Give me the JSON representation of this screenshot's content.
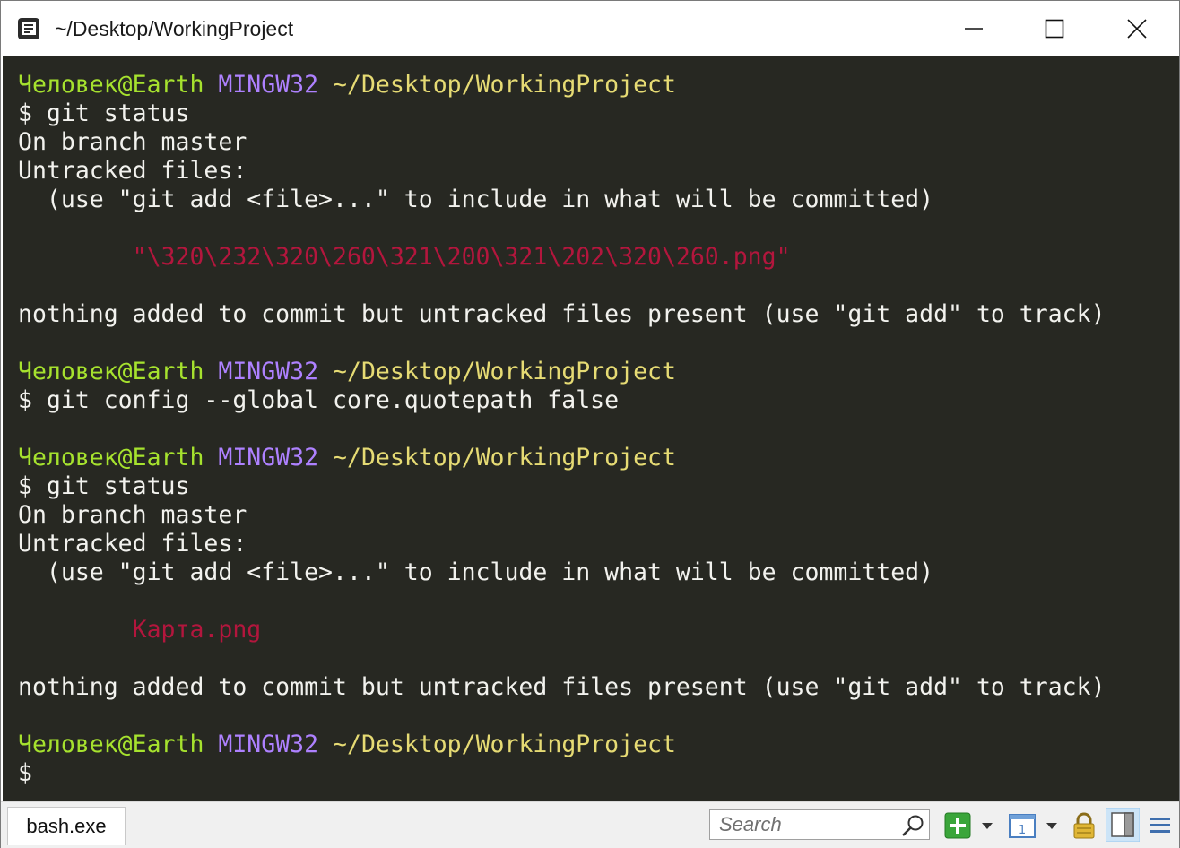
{
  "window": {
    "title": "~/Desktop/WorkingProject"
  },
  "terminal": {
    "lines": [
      {
        "type": "prompt",
        "user": "Человек@Earth",
        "host": "MINGW32",
        "path": "~/Desktop/WorkingProject"
      },
      {
        "type": "text",
        "text": "$ git status"
      },
      {
        "type": "text",
        "text": "On branch master"
      },
      {
        "type": "text",
        "text": "Untracked files:"
      },
      {
        "type": "text",
        "text": "  (use \"git add <file>...\" to include in what will be committed)"
      },
      {
        "type": "text",
        "text": ""
      },
      {
        "type": "untracked",
        "text": "        \"\\320\\232\\320\\260\\321\\200\\321\\202\\320\\260.png\""
      },
      {
        "type": "text",
        "text": ""
      },
      {
        "type": "text",
        "text": "nothing added to commit but untracked files present (use \"git add\" to track)"
      },
      {
        "type": "text",
        "text": ""
      },
      {
        "type": "prompt",
        "user": "Человек@Earth",
        "host": "MINGW32",
        "path": "~/Desktop/WorkingProject"
      },
      {
        "type": "text",
        "text": "$ git config --global core.quotepath false"
      },
      {
        "type": "text",
        "text": ""
      },
      {
        "type": "prompt",
        "user": "Человек@Earth",
        "host": "MINGW32",
        "path": "~/Desktop/WorkingProject"
      },
      {
        "type": "text",
        "text": "$ git status"
      },
      {
        "type": "text",
        "text": "On branch master"
      },
      {
        "type": "text",
        "text": "Untracked files:"
      },
      {
        "type": "text",
        "text": "  (use \"git add <file>...\" to include in what will be committed)"
      },
      {
        "type": "text",
        "text": ""
      },
      {
        "type": "untracked",
        "text": "        Карта.png"
      },
      {
        "type": "text",
        "text": ""
      },
      {
        "type": "text",
        "text": "nothing added to commit but untracked files present (use \"git add\" to track)"
      },
      {
        "type": "text",
        "text": ""
      },
      {
        "type": "prompt",
        "user": "Человек@Earth",
        "host": "MINGW32",
        "path": "~/Desktop/WorkingProject"
      },
      {
        "type": "text",
        "text": "$"
      }
    ]
  },
  "statusbar": {
    "console_tab": "bash.exe",
    "search_placeholder": "Search"
  },
  "colors": {
    "terminal_bg": "#272822",
    "prompt_user": "#a6e22e",
    "prompt_host": "#ae81ff",
    "prompt_path": "#e6db74",
    "untracked": "#b3163d",
    "text": "#f2f2ee"
  },
  "icons": [
    "console-app-icon",
    "minimize-icon",
    "maximize-icon",
    "close-icon",
    "search-icon",
    "new-console-icon",
    "dropdown-icon",
    "console-list-icon",
    "lock-icon",
    "split-view-icon",
    "menu-icon"
  ]
}
